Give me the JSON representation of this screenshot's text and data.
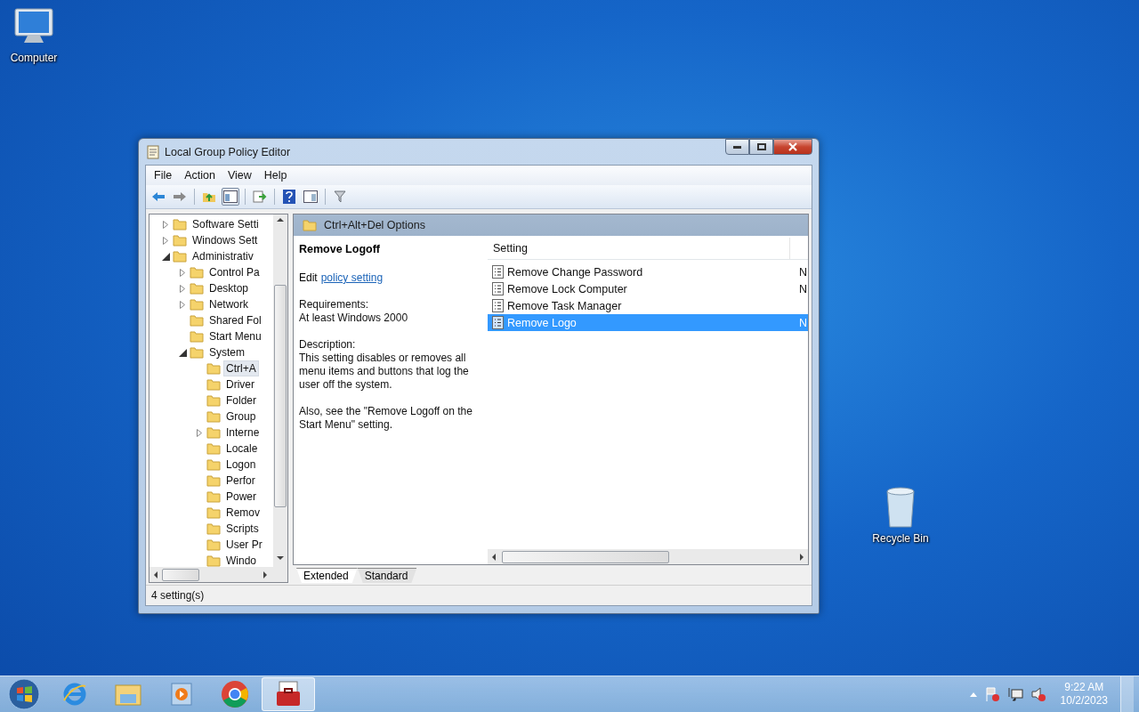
{
  "desktop_icons": [
    {
      "label": "Computer"
    },
    {
      "label": "Recycle Bin"
    }
  ],
  "window": {
    "title": "Local Group Policy Editor",
    "menu": [
      "File",
      "Action",
      "View",
      "Help"
    ],
    "tree": [
      {
        "label": "Software Setti",
        "expandable": true,
        "expanded": false,
        "selected": false
      },
      {
        "label": "Windows Sett",
        "expandable": true,
        "expanded": false,
        "selected": false
      },
      {
        "label": "Administrativ",
        "expandable": true,
        "expanded": true,
        "selected": false,
        "children": [
          {
            "label": "Control Pa",
            "expandable": true,
            "expanded": false,
            "selected": false
          },
          {
            "label": "Desktop",
            "expandable": true,
            "expanded": false,
            "selected": false
          },
          {
            "label": "Network",
            "expandable": true,
            "expanded": false,
            "selected": false
          },
          {
            "label": "Shared Fol",
            "expandable": false,
            "selected": false
          },
          {
            "label": "Start Menu",
            "expandable": false,
            "selected": false
          },
          {
            "label": "System",
            "expandable": true,
            "expanded": true,
            "selected": false,
            "children": [
              {
                "label": "Ctrl+A",
                "expandable": false,
                "selected": true
              },
              {
                "label": "Driver",
                "expandable": false,
                "selected": false
              },
              {
                "label": "Folder",
                "expandable": false,
                "selected": false
              },
              {
                "label": "Group",
                "expandable": false,
                "selected": false
              },
              {
                "label": "Interne",
                "expandable": true,
                "expanded": false,
                "selected": false
              },
              {
                "label": "Locale",
                "expandable": false,
                "selected": false
              },
              {
                "label": "Logon",
                "expandable": false,
                "selected": false
              },
              {
                "label": "Perfor",
                "expandable": false,
                "selected": false
              },
              {
                "label": "Power",
                "expandable": false,
                "selected": false
              },
              {
                "label": "Remov",
                "expandable": false,
                "selected": false
              },
              {
                "label": "Scripts",
                "expandable": false,
                "selected": false
              },
              {
                "label": "User Pr",
                "expandable": false,
                "selected": false
              },
              {
                "label": "Windo",
                "expandable": false,
                "selected": false
              }
            ]
          }
        ]
      }
    ],
    "pane_title": "Ctrl+Alt+Del Options",
    "description": {
      "title": "Remove Logoff",
      "edit_prefix": "Edit",
      "edit_link": "policy setting",
      "requirements_label": "Requirements:",
      "requirements": "At least Windows 2000",
      "description_label": "Description:",
      "description": "This setting disables or removes all menu items and buttons that log the user off the system.",
      "note": "Also, see the \"Remove Logoff on the Start Menu\" setting."
    },
    "table": {
      "columns": [
        "Setting"
      ],
      "rows": [
        {
          "setting": "Remove Change Password",
          "column_2": "N",
          "selected": false
        },
        {
          "setting": "Remove Lock Computer",
          "column_2": "N",
          "selected": false
        },
        {
          "setting": "Remove Task Manager",
          "selected": false
        },
        {
          "setting": "Remove Logo",
          "column_2": "N",
          "selected": true
        }
      ]
    },
    "tabs": [
      {
        "label": "Extended",
        "selected": true
      },
      {
        "label": "Standard",
        "selected": false
      }
    ],
    "status_bar": "4 setting(s)"
  },
  "taskbar": {
    "apps": [
      {
        "active": false
      },
      {
        "active": false
      },
      {
        "active": false
      },
      {
        "active": false
      },
      {
        "active": true
      }
    ],
    "time": "9:22 AM",
    "date": "10/2/2023"
  }
}
